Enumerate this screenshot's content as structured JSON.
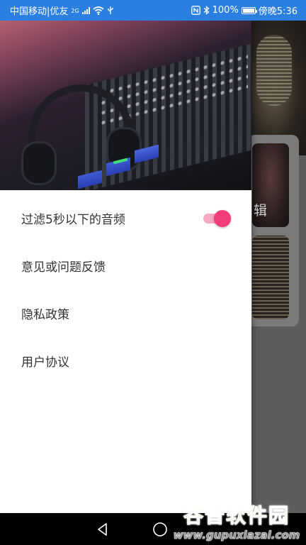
{
  "status_bar": {
    "carrier": "中国移动|优友",
    "network": "2G",
    "battery_percent": "100%",
    "time": "傍晚5:36"
  },
  "background": {
    "album_label": "辑"
  },
  "drawer": {
    "menu": [
      {
        "label": "过滤5秒以下的音频",
        "toggle_on": true
      },
      {
        "label": "意见或问题反馈"
      },
      {
        "label": "隐私政策"
      },
      {
        "label": "用户协议"
      }
    ],
    "accent_color": "#f23d7a"
  },
  "watermark": {
    "title": "谷普软件园",
    "url": "www.gupuxlazal.com"
  }
}
